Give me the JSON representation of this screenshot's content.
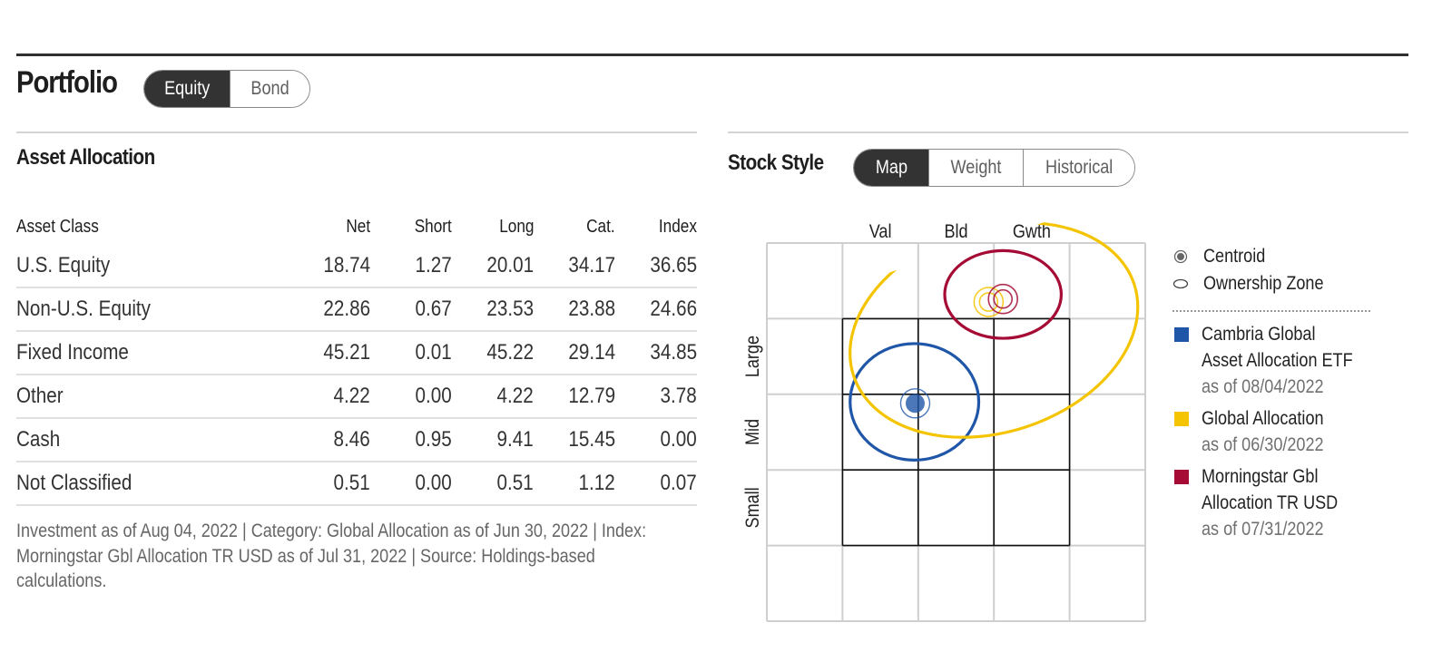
{
  "header": {
    "title": "Portfolio",
    "tabs": [
      {
        "label": "Equity",
        "active": true
      },
      {
        "label": "Bond",
        "active": false
      }
    ]
  },
  "asset_allocation": {
    "title": "Asset Allocation",
    "columns": [
      "Asset Class",
      "Net",
      "Short",
      "Long",
      "Cat.",
      "Index"
    ],
    "rows": [
      {
        "name": "U.S. Equity",
        "net": "18.74",
        "short": "1.27",
        "long": "20.01",
        "cat": "34.17",
        "index": "36.65"
      },
      {
        "name": "Non-U.S. Equity",
        "net": "22.86",
        "short": "0.67",
        "long": "23.53",
        "cat": "23.88",
        "index": "24.66"
      },
      {
        "name": "Fixed Income",
        "net": "45.21",
        "short": "0.01",
        "long": "45.22",
        "cat": "29.14",
        "index": "34.85"
      },
      {
        "name": "Other",
        "net": "4.22",
        "short": "0.00",
        "long": "4.22",
        "cat": "12.79",
        "index": "3.78"
      },
      {
        "name": "Cash",
        "net": "8.46",
        "short": "0.95",
        "long": "9.41",
        "cat": "15.45",
        "index": "0.00"
      },
      {
        "name": "Not Classified",
        "net": "0.51",
        "short": "0.00",
        "long": "0.51",
        "cat": "1.12",
        "index": "0.07"
      }
    ],
    "footnote": "Investment as of Aug 04, 2022 | Category: Global Allocation as of Jun 30, 2022 | Index: Morningstar Gbl Allocation TR USD as of Jul 31, 2022 | Source: Holdings-based calculations."
  },
  "stock_style": {
    "title": "Stock Style",
    "tabs": [
      {
        "label": "Map",
        "active": true
      },
      {
        "label": "Weight",
        "active": false
      },
      {
        "label": "Historical",
        "active": false
      }
    ],
    "legend": {
      "centroid_label": "Centroid",
      "zone_label": "Ownership Zone",
      "series": [
        {
          "name": "Cambria Global Asset Allocation ETF",
          "as_of": "as of 08/04/2022",
          "color": "#1f56a8"
        },
        {
          "name": "Global Allocation",
          "as_of": "as of 06/30/2022",
          "color": "#f5c400"
        },
        {
          "name": "Morningstar Gbl Allocation TR USD",
          "as_of": "as of 07/31/2022",
          "color": "#a50b34"
        }
      ]
    }
  },
  "chart_data": {
    "type": "scatter",
    "title": "Stock Style Map",
    "x_labels": [
      "Val",
      "Bld",
      "Gwth"
    ],
    "y_labels": [
      "Large",
      "Mid",
      "Small"
    ],
    "x_range": [
      -1.5,
      3.5
    ],
    "y_range": [
      -1.5,
      3.5
    ],
    "grid": true,
    "legend_position": "right",
    "series": [
      {
        "name": "Cambria Global Asset Allocation ETF",
        "color": "#1f56a8",
        "centroid": {
          "x": 0.46,
          "y": 1.38
        },
        "zone": {
          "rx": 0.85,
          "ry": 0.77,
          "rotation": 0,
          "cx": 0.45,
          "cy": 1.4
        }
      },
      {
        "name": "Global Allocation",
        "color": "#f5c400",
        "centroid": {
          "x": 1.43,
          "y": 2.72
        },
        "zone": {
          "rx": 1.95,
          "ry": 1.35,
          "rotation": -18,
          "cx": 1.5,
          "cy": 2.35
        }
      },
      {
        "name": "Morningstar Gbl Allocation TR USD",
        "color": "#a50b34",
        "centroid": {
          "x": 1.62,
          "y": 2.76
        },
        "zone": {
          "rx": 0.77,
          "ry": 0.58,
          "rotation": 0,
          "cx": 1.62,
          "cy": 2.82
        }
      }
    ]
  }
}
